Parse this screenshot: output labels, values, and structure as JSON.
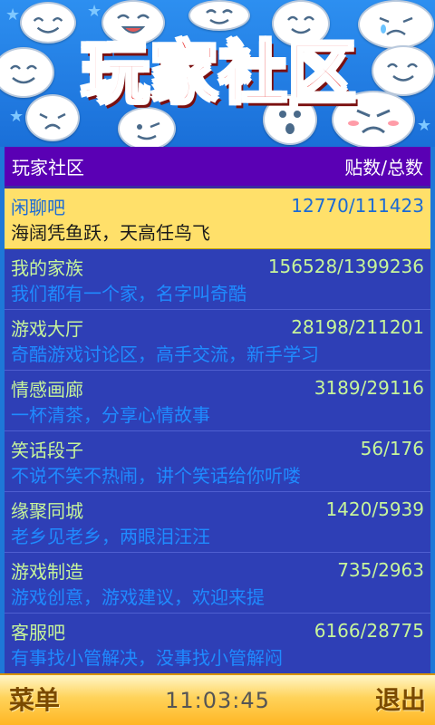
{
  "banner": {
    "title": "玩家社区"
  },
  "header": {
    "title": "玩家社区",
    "count_label": "贴数/总数"
  },
  "forums": [
    {
      "name": "闲聊吧",
      "count": "12770/111423",
      "desc": "海阔凭鱼跃，天高任鸟飞",
      "selected": true
    },
    {
      "name": "我的家族",
      "count": "156528/1399236",
      "desc": "我们都有一个家，名字叫奇酷"
    },
    {
      "name": "游戏大厅",
      "count": "28198/211201",
      "desc": "奇酷游戏讨论区，高手交流，新手学习"
    },
    {
      "name": "情感画廊",
      "count": "3189/29116",
      "desc": "一杯清茶，分享心情故事"
    },
    {
      "name": "笑话段子",
      "count": "56/176",
      "desc": "不说不笑不热闹，讲个笑话给你听喽"
    },
    {
      "name": "缘聚同城",
      "count": "1420/5939",
      "desc": "老乡见老乡，两眼泪汪汪"
    },
    {
      "name": "游戏制造",
      "count": "735/2963",
      "desc": "游戏创意，游戏建议，欢迎来提"
    },
    {
      "name": "客服吧",
      "count": "6166/28775",
      "desc": "有事找小管解决，没事找小管解闷"
    }
  ],
  "bottom_bar": {
    "menu_label": "菜单",
    "time": "11:03:45",
    "exit_label": "退出"
  },
  "colors": {
    "panel_bg": "#2e3fb6",
    "header_bg": "#5a00b4",
    "selected_bg": "#ffe06a",
    "name_text": "#c7f59a",
    "desc_text": "#1f8bff"
  }
}
